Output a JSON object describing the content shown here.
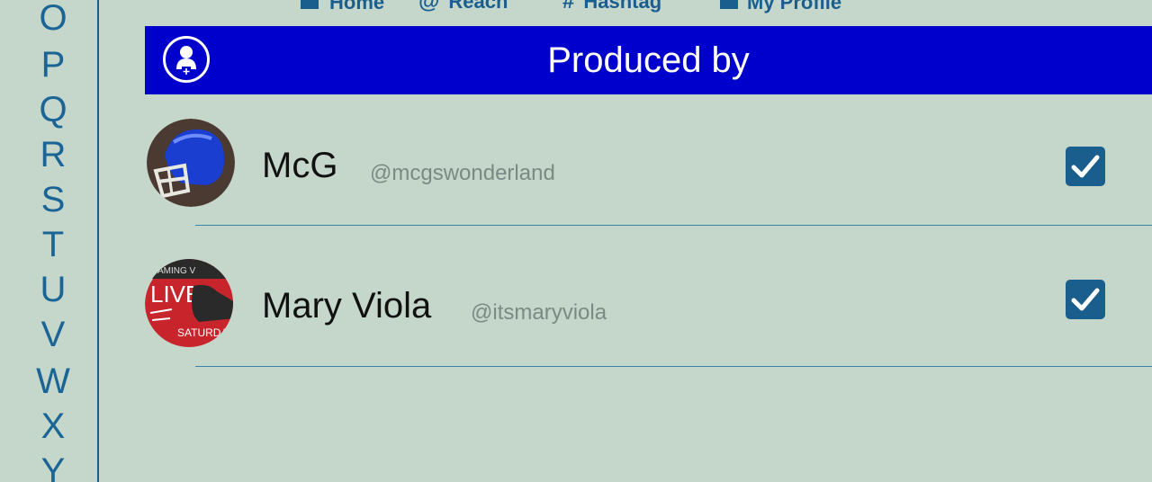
{
  "alphabet_index": [
    "O",
    "P",
    "Q",
    "R",
    "S",
    "T",
    "U",
    "V",
    "W",
    "X",
    "Y"
  ],
  "top_nav": [
    {
      "label": "Home",
      "icon": "home-icon"
    },
    {
      "label": "Reach",
      "icon": "at-icon"
    },
    {
      "label": "Hashtag",
      "icon": "hashtag-icon"
    },
    {
      "label": "My Profile",
      "icon": "profile-icon"
    }
  ],
  "header": {
    "title": "Produced by",
    "icon": "add-user-icon",
    "background": "#0000cc"
  },
  "producers": [
    {
      "name": "McG",
      "handle": "@mcgswonderland",
      "checked": true,
      "avatar": "football-helmet"
    },
    {
      "name": "Mary Viola",
      "handle": "@itsmaryviola",
      "checked": true,
      "avatar": "live-saturday"
    }
  ],
  "colors": {
    "background": "#c5d6cb",
    "accent": "#1a5e8e",
    "header": "#0000cc"
  }
}
